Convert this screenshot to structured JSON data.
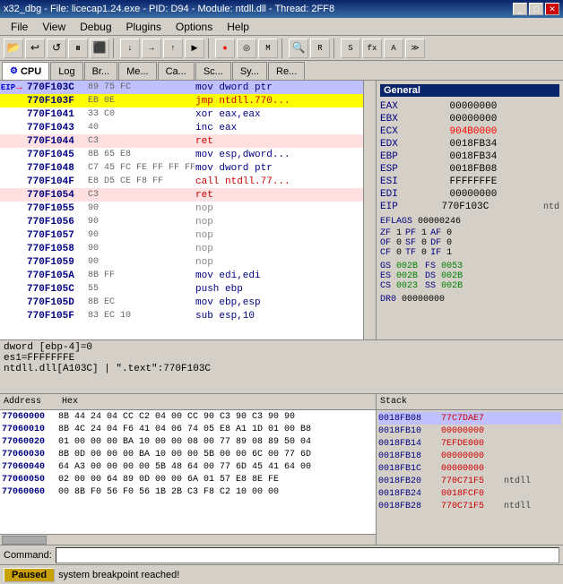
{
  "titleBar": {
    "text": "x32_dbg - File: licecap1.24.exe - PID: D94 - Module: ntdll.dll - Thread: 2FF8",
    "buttons": [
      "_",
      "□",
      "✕"
    ]
  },
  "menuBar": {
    "items": [
      "File",
      "View",
      "Debug",
      "Plugins",
      "Options",
      "Help"
    ]
  },
  "tabs": [
    {
      "label": "CPU",
      "active": true
    },
    {
      "label": "Log"
    },
    {
      "label": "Br..."
    },
    {
      "label": "Me..."
    },
    {
      "label": "Ca..."
    },
    {
      "label": "Sc..."
    },
    {
      "label": "Sy..."
    },
    {
      "label": "Re..."
    }
  ],
  "asm": {
    "rows": [
      {
        "addr": "770F103C",
        "hex": "89 75 FC",
        "instr": "mov dword ptr",
        "eip": true,
        "arrow": true
      },
      {
        "addr": "770F103F",
        "hex": "EB 0E",
        "instr": "jmp ntdll.770...",
        "highlight": true
      },
      {
        "addr": "770F1041",
        "hex": "33 C0",
        "instr": "xor eax,eax"
      },
      {
        "addr": "770F1043",
        "hex": "40",
        "instr": "inc eax",
        "ret": true
      },
      {
        "addr": "770F1044",
        "hex": "C3",
        "instr": "ret",
        "ret_bg": true
      },
      {
        "addr": "770F1045",
        "hex": "8B 65 E8",
        "instr": "mov esp,dword..."
      },
      {
        "addr": "770F1048",
        "hex": "C7 45 FC FE FF FF FF",
        "instr": "mov dword ptr"
      },
      {
        "addr": "770F104F",
        "hex": "E8 D5 CE F8 FF",
        "instr": "call ntdll.77...",
        "call": true
      },
      {
        "addr": "770F1054",
        "hex": "C3",
        "instr": "ret",
        "ret_bg": true
      },
      {
        "addr": "770F1055",
        "hex": "90",
        "instr": "nop"
      },
      {
        "addr": "770F1056",
        "hex": "90",
        "instr": "nop"
      },
      {
        "addr": "770F1057",
        "hex": "90",
        "instr": "nop"
      },
      {
        "addr": "770F1058",
        "hex": "90",
        "instr": "nop"
      },
      {
        "addr": "770F1059",
        "hex": "90",
        "instr": "nop"
      },
      {
        "addr": "770F105A",
        "hex": "8B FF",
        "instr": "mov edi,edi"
      },
      {
        "addr": "770F105C",
        "hex": "55",
        "instr": "push ebp"
      },
      {
        "addr": "770F105D",
        "hex": "8B EC",
        "instr": "mov ebp,esp"
      },
      {
        "addr": "770F105F",
        "hex": "83 EC 10",
        "instr": "sub esp,10"
      }
    ]
  },
  "registers": {
    "title": "General",
    "regs": [
      {
        "name": "EAX",
        "value": "00000000"
      },
      {
        "name": "EBX",
        "value": "00000000"
      },
      {
        "name": "ECX",
        "value": "904B0000",
        "changed": true
      },
      {
        "name": "EDX",
        "value": "0018FB34"
      },
      {
        "name": "EBP",
        "value": "0018FB34"
      },
      {
        "name": "ESP",
        "value": "0018FB08"
      },
      {
        "name": "ESI",
        "value": "FFFFFFFE"
      },
      {
        "name": "EDI",
        "value": "00000000"
      },
      {
        "name": "EIP",
        "value": "770F103C",
        "comment": "ntd"
      },
      {
        "name": "EFLAGS",
        "value": "00000246"
      }
    ],
    "flags": [
      {
        "name": "ZF",
        "val": "1"
      },
      {
        "name": "PF",
        "val": "1"
      },
      {
        "name": "AF",
        "val": "0"
      },
      {
        "name": "OF",
        "val": "0"
      },
      {
        "name": "SF",
        "val": "0"
      },
      {
        "name": "DF",
        "val": "0"
      },
      {
        "name": "CF",
        "val": "0"
      },
      {
        "name": "TF",
        "val": "0"
      },
      {
        "name": "IF",
        "val": "1"
      }
    ],
    "segs": [
      {
        "name": "GS",
        "val": "002B"
      },
      {
        "name": "FS",
        "val": "0053"
      },
      {
        "name": "ES",
        "val": "002B"
      },
      {
        "name": "DS",
        "val": "002B"
      },
      {
        "name": "CS",
        "val": "0023"
      },
      {
        "name": "SS",
        "val": "002B"
      }
    ],
    "dr": [
      {
        "name": "DR0",
        "val": "00000000"
      }
    ]
  },
  "infoBar": {
    "lines": [
      "dword [ebp-4]=0",
      "es1=FFFFFFFE",
      "ntdll.dll[A103C] | \".text\":770F103C"
    ]
  },
  "memory": {
    "header": [
      "Address",
      "Hex"
    ],
    "rows": [
      {
        "addr": "77060000",
        "hex": "8B 44 24 04 CC C2 04 00 CC 90 C3 90 C3 90 90"
      },
      {
        "addr": "77060010",
        "hex": "8B 4C 24 04 F6 41 04 06 74 05 E8 A1 1D 01 00 B8"
      },
      {
        "addr": "77060020",
        "hex": "01 00 00 00 BA 10 00 00 08 00 77 89 08 89 50 04"
      },
      {
        "addr": "77060030",
        "hex": "8B 0D 00 00 00 BA 10 00 00 5B 00 00 6C 00 77 6D"
      },
      {
        "addr": "77060040",
        "hex": "64 A3 00 00 00 00 5B 48 64 00 77 6D 45 41 64 00"
      },
      {
        "addr": "77060050",
        "hex": "02 00 00 64 89 0D 00 00 6A 01 57 E8 8E FE"
      },
      {
        "addr": "77060060",
        "hex": "00 8B F0 56 F0 56 1B 2B C3 F8 C2 10 00 00"
      }
    ]
  },
  "stack": {
    "rows": [
      {
        "addr": "0018FB08",
        "val": "77C7DAE7",
        "comment": "",
        "highlighted": true
      },
      {
        "addr": "0018FB10",
        "val": "00000000",
        "comment": ""
      },
      {
        "addr": "0018FB14",
        "val": "7EFDE000",
        "comment": ""
      },
      {
        "addr": "0018FB18",
        "val": "00000000",
        "comment": ""
      },
      {
        "addr": "0018FB1C",
        "val": "00000000",
        "comment": ""
      },
      {
        "addr": "0018FB20",
        "val": "770C71F5",
        "comment": "ntdll"
      },
      {
        "addr": "0018FB24",
        "val": "0018FCF0",
        "comment": ""
      },
      {
        "addr": "0018FB28",
        "val": "770C71F5",
        "comment": "ntdll"
      }
    ]
  },
  "commandBar": {
    "label": "Command:",
    "placeholder": ""
  },
  "statusBar": {
    "status": "Paused",
    "message": "system breakpoint reached!"
  }
}
